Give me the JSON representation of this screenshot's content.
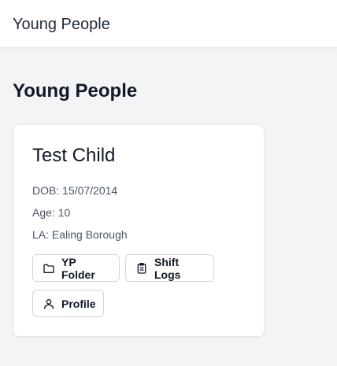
{
  "topbar": {
    "title": "Young People"
  },
  "page": {
    "heading": "Young People"
  },
  "card": {
    "name": "Test Child",
    "dob": "DOB: 15/07/2014",
    "age": "Age: 10",
    "la": "LA: Ealing Borough",
    "buttons": {
      "folder": {
        "label": "YP Folder",
        "icon": "folder-icon"
      },
      "shift_logs": {
        "label": "Shift Logs",
        "icon": "clipboard-icon"
      },
      "profile": {
        "label": "Profile",
        "icon": "user-icon"
      }
    }
  }
}
